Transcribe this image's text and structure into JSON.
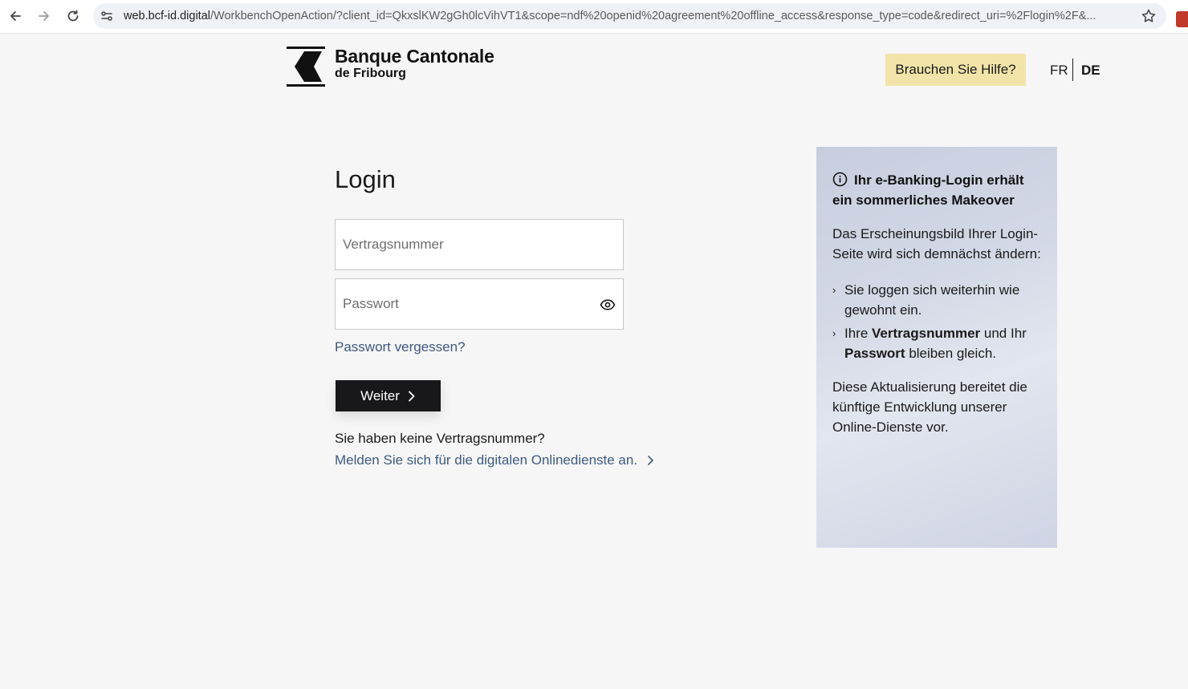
{
  "browser": {
    "url_host": "web.bcf-id.digital",
    "url_path": "/WorkbenchOpenAction/?client_id=QkxslKW2gGh0lcVihVT1&scope=ndf%20openid%20agreement%20offline_access&response_type=code&redirect_uri=%2Flogin%2F&..."
  },
  "header": {
    "logo_line1": "Banque Cantonale",
    "logo_line2": "de Fribourg",
    "help_label": "Brauchen Sie Hilfe?",
    "lang_fr": "FR",
    "lang_de": "DE"
  },
  "login": {
    "title": "Login",
    "contract_placeholder": "Vertragsnummer",
    "password_placeholder": "Passwort",
    "forgot_label": "Passwort vergessen?",
    "submit_label": "Weiter",
    "no_contract_text": "Sie haben keine Vertragsnummer?",
    "register_label": "Melden Sie sich für die digitalen Onlinedienste an."
  },
  "info_panel": {
    "title": "Ihr e-Banking-Login erhält ein sommerliches Makeover",
    "intro": "Das Erscheinungsbild Ihrer Login-Seite wird sich demnächst ändern:",
    "bullet1": "Sie loggen sich weiterhin wie gewohnt ein.",
    "bullet2_pre": "Ihre ",
    "bullet2_b1": "Vertragsnummer",
    "bullet2_mid": " und Ihr ",
    "bullet2_b2": "Passwort",
    "bullet2_post": " bleiben gleich.",
    "outro": "Diese Aktualisierung bereitet die künftige Entwicklung unserer Online-Dienste vor."
  },
  "colors": {
    "page_bg": "#f6f6f6",
    "help_button_bg": "#f2e4a9",
    "primary_button_bg": "#18181a",
    "link": "#3d5a80"
  }
}
